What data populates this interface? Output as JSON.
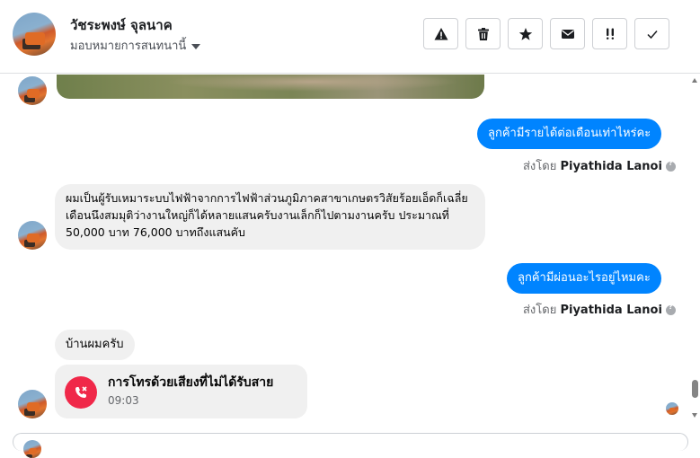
{
  "header": {
    "contact_name": "วัชระพงษ์ จุลนาค",
    "assign_label": "มอบหมายการสนทนานี้",
    "toolbar_icons": [
      "warning-icon",
      "trash-icon",
      "star-icon",
      "envelope-icon",
      "double-exclamation-icon",
      "check-icon"
    ]
  },
  "messages": {
    "outgoing_1": "ลูกค้ามีรายได้ต่อเดือนเท่าไหร่คะ",
    "sent_by_1_prefix": "ส่งโดย",
    "sent_by_1_name": "Piyathida Lanoi",
    "incoming_1": "ผมเป็นผู้รับเหมาระบบไฟฟ้าจากการไฟฟ้าส่วนภูมิภาคสาขาเกษตรวิสัยร้อยเอ็ดก็เฉลี่ยเดือนนึงสมมุติว่างานใหญ่ก็ได้หลายแสนครับงานเล็กก็ไปตามงานครับ ประมาณที่ 50,000 บาท 76,000 บาทถึงแสนคับ",
    "outgoing_2": "ลูกค้ามีผ่อนอะไรอยู่ไหมคะ",
    "sent_by_2_prefix": "ส่งโดย",
    "sent_by_2_name": "Piyathida Lanoi",
    "incoming_2": "บ้านผมครับ",
    "missed_call_title": "การโทรด้วยเสียงที่ไม่ได้รับสาย",
    "missed_call_time": "09:03"
  },
  "colors": {
    "outgoing_bubble": "#0084ff",
    "incoming_bubble": "#f0f0f0",
    "missed_call": "#f02849"
  }
}
